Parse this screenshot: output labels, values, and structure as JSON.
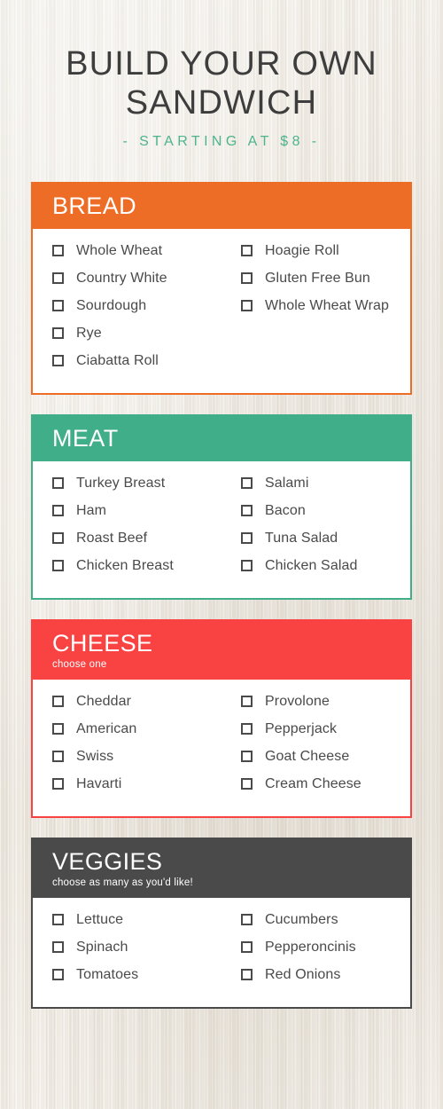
{
  "header": {
    "title": "BUILD YOUR OWN SANDWICH",
    "subtitle": "- STARTING AT $8 -",
    "title_color": "#3d3d3d",
    "subtitle_color": "#4fb38c"
  },
  "background_color": "#ece7de",
  "sections": [
    {
      "id": "bread",
      "title": "BREAD",
      "subtitle": "",
      "color": "#ed6c26",
      "left_column": [
        {
          "label": "Whole Wheat",
          "checked": false
        },
        {
          "label": "Country White",
          "checked": false
        },
        {
          "label": "Sourdough",
          "checked": false
        },
        {
          "label": "Rye",
          "checked": false
        },
        {
          "label": "Ciabatta Roll",
          "checked": false
        }
      ],
      "right_column": [
        {
          "label": "Hoagie Roll",
          "checked": false
        },
        {
          "label": "Gluten Free Bun",
          "checked": false
        },
        {
          "label": "Whole Wheat Wrap",
          "checked": false
        }
      ]
    },
    {
      "id": "meat",
      "title": "MEAT",
      "subtitle": "",
      "color": "#40ae88",
      "left_column": [
        {
          "label": "Turkey Breast",
          "checked": false
        },
        {
          "label": "Ham",
          "checked": false
        },
        {
          "label": "Roast Beef",
          "checked": false
        },
        {
          "label": "Chicken Breast",
          "checked": false
        }
      ],
      "right_column": [
        {
          "label": "Salami",
          "checked": false
        },
        {
          "label": "Bacon",
          "checked": false
        },
        {
          "label": "Tuna Salad",
          "checked": false
        },
        {
          "label": "Chicken Salad",
          "checked": false
        }
      ]
    },
    {
      "id": "cheese",
      "title": "CHEESE",
      "subtitle": "choose one",
      "color": "#f94343",
      "left_column": [
        {
          "label": "Cheddar",
          "checked": false
        },
        {
          "label": "American",
          "checked": false
        },
        {
          "label": "Swiss",
          "checked": false
        },
        {
          "label": "Havarti",
          "checked": false
        }
      ],
      "right_column": [
        {
          "label": "Provolone",
          "checked": false
        },
        {
          "label": "Pepperjack",
          "checked": false
        },
        {
          "label": "Goat Cheese",
          "checked": false
        },
        {
          "label": "Cream Cheese",
          "checked": false
        }
      ]
    },
    {
      "id": "veggies",
      "title": "VEGGIES",
      "subtitle": "choose as many as you'd like!",
      "color": "#4a4a4a",
      "left_column": [
        {
          "label": "Lettuce",
          "checked": false
        },
        {
          "label": "Spinach",
          "checked": false
        },
        {
          "label": "Tomatoes",
          "checked": false
        }
      ],
      "right_column": [
        {
          "label": "Cucumbers",
          "checked": false
        },
        {
          "label": "Pepperoncinis",
          "checked": false
        },
        {
          "label": "Red Onions",
          "checked": false
        }
      ]
    }
  ]
}
